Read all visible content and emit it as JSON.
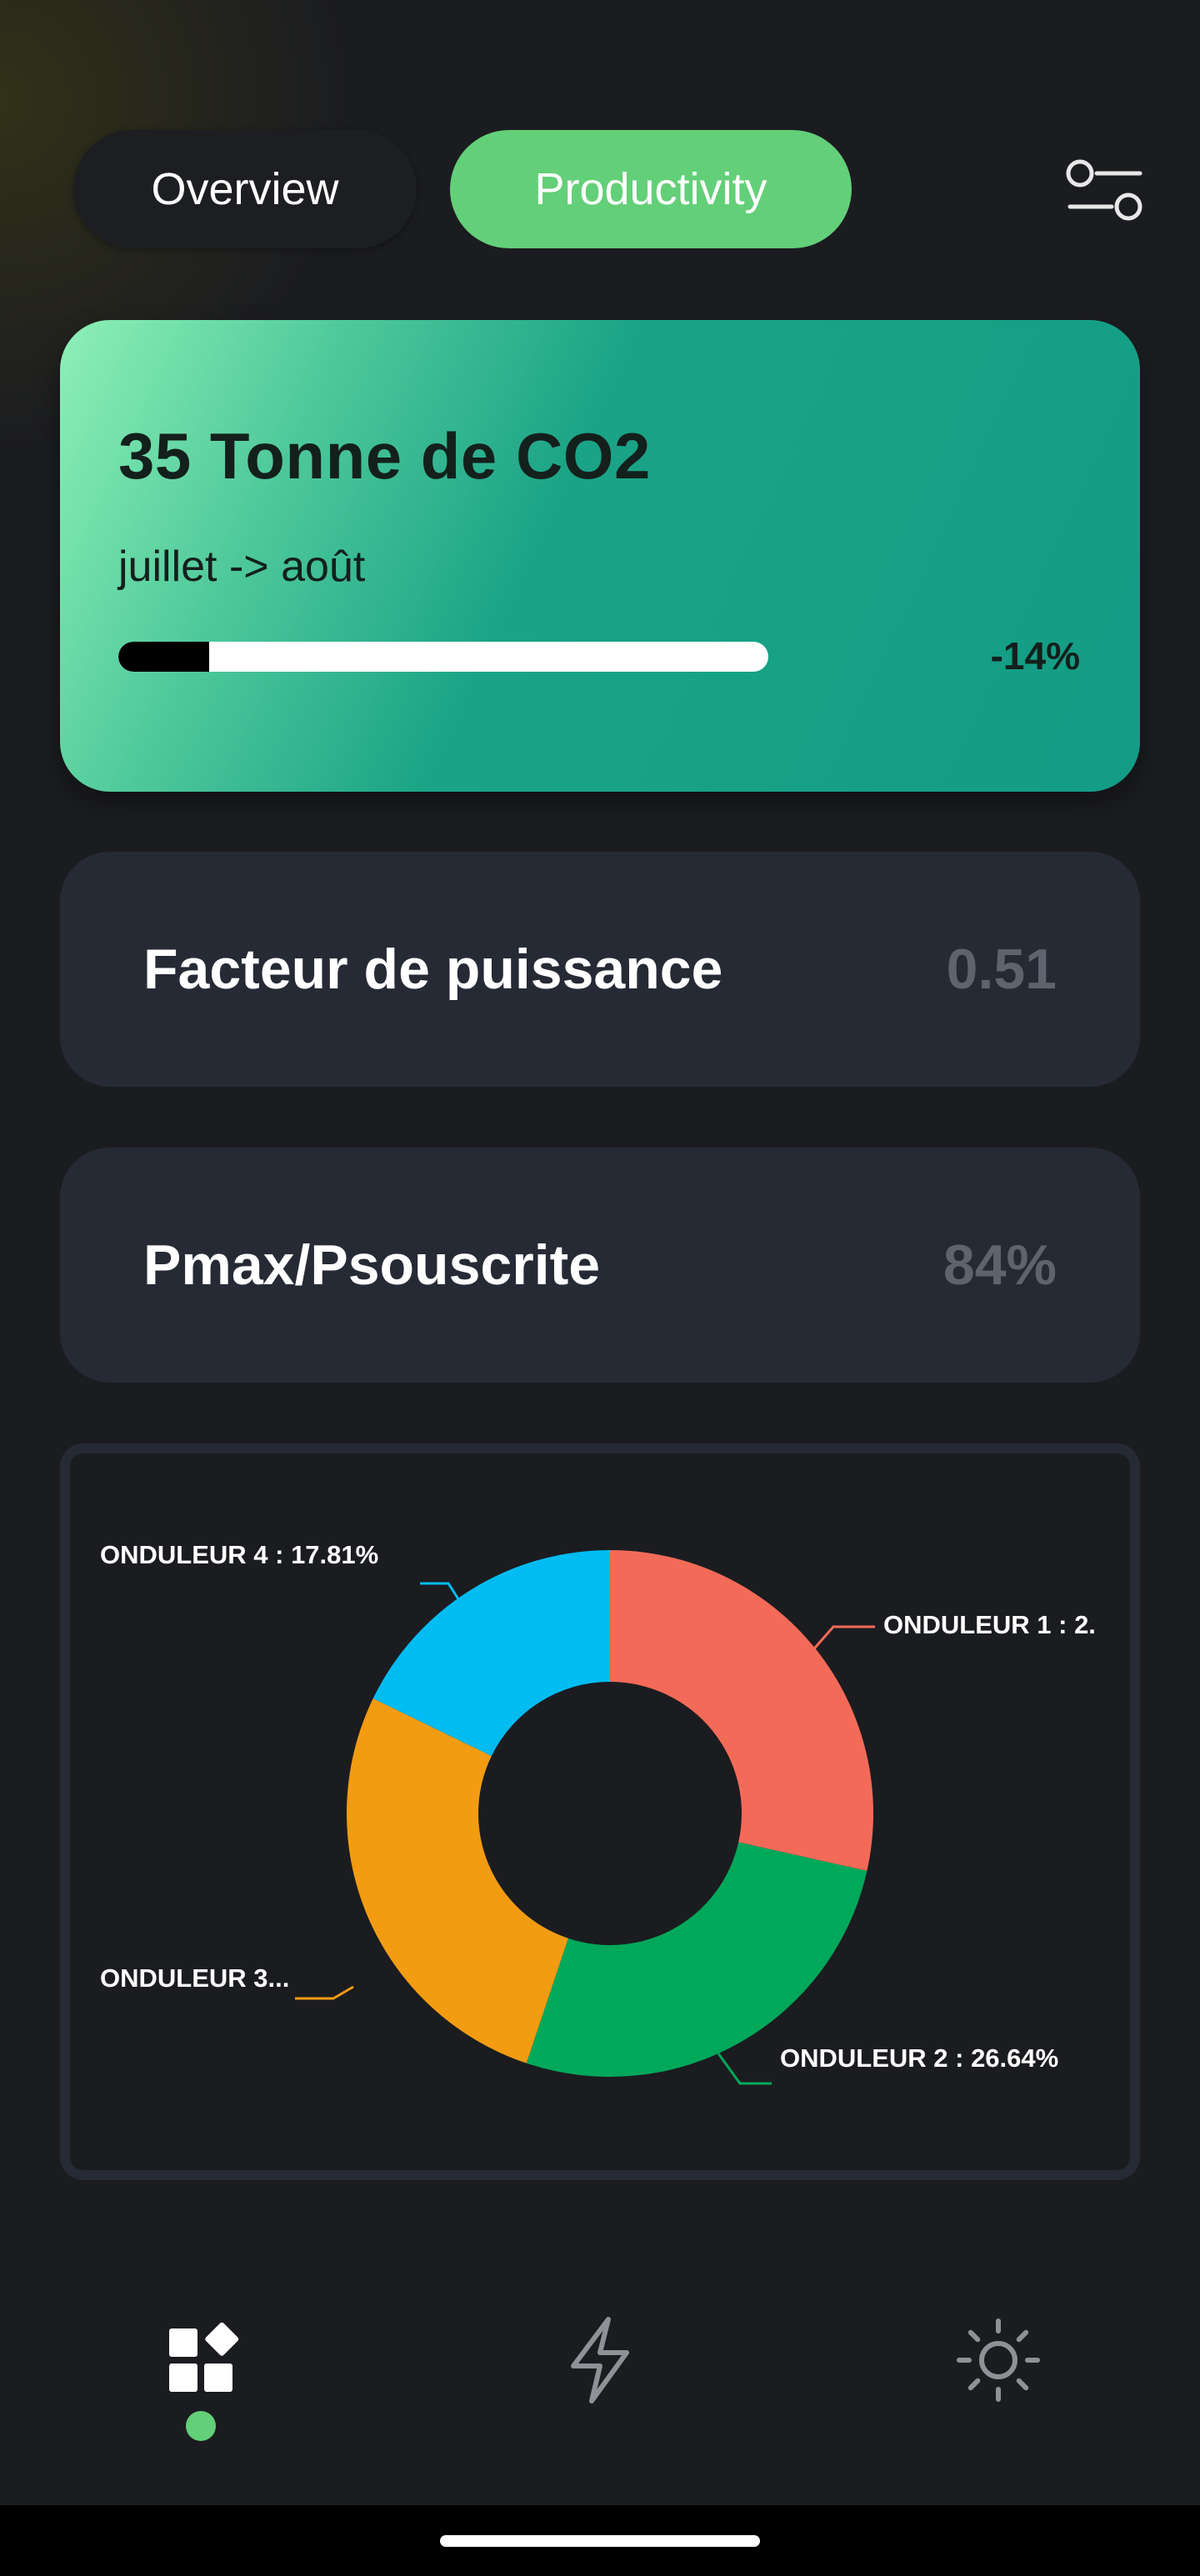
{
  "tabs": {
    "overview": "Overview",
    "productivity": "Productivity",
    "active": "productivity"
  },
  "co2_card": {
    "title": "35 Tonne de CO2",
    "period": "juillet -> août",
    "delta": "-14%",
    "progress_fraction": 0.14
  },
  "metrics": [
    {
      "label": "Facteur de puissance",
      "value": "0.51"
    },
    {
      "label": "Pmax/Psouscrite",
      "value": "84%"
    }
  ],
  "chart_data": {
    "type": "pie",
    "donut": true,
    "categories": [
      "ONDULEUR 1",
      "ONDULEUR 2",
      "ONDULEUR 3",
      "ONDULEUR 4"
    ],
    "values": [
      28.5,
      26.64,
      27.05,
      17.81
    ],
    "labels": [
      "ONDULEUR 1 : 2.",
      "ONDULEUR 2 : 26.64%",
      "ONDULEUR 3...",
      "ONDULEUR 4 : 17.81%"
    ],
    "colors": [
      "#f46a58",
      "#00a85a",
      "#f39c12",
      "#00bcf0"
    ],
    "start_angle_deg": 0,
    "direction": "clockwise"
  },
  "nav": {
    "items": [
      "dashboard-icon",
      "bolt-icon",
      "sun-icon"
    ],
    "active_index": 0
  },
  "colors": {
    "background": "#1b1c20",
    "card": "#262a35",
    "accent_green": "#63cf78",
    "co2_gradient_start": "#8ef0b6",
    "co2_gradient_end": "#139c86"
  }
}
